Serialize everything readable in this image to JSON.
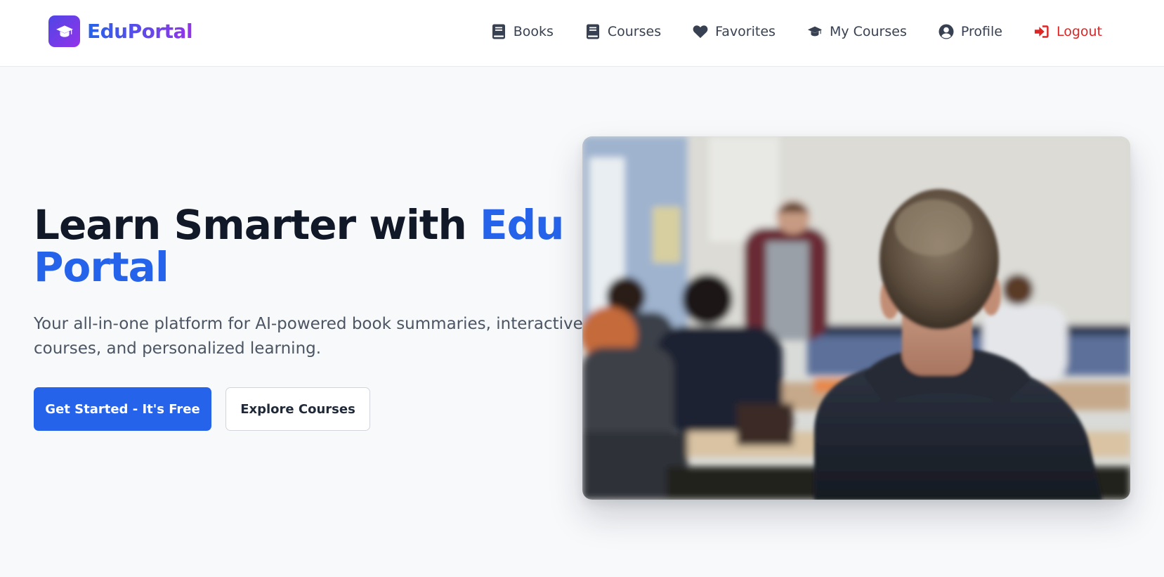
{
  "brand": {
    "name": "EduPortal",
    "logo_icon": "graduation-cap-icon",
    "gradient": [
      "#4f46e5",
      "#9333ea"
    ]
  },
  "nav": {
    "items": [
      {
        "label": "Books",
        "icon": "book-icon"
      },
      {
        "label": "Courses",
        "icon": "book-icon"
      },
      {
        "label": "Favorites",
        "icon": "heart-icon"
      },
      {
        "label": "My Courses",
        "icon": "graduation-cap-icon"
      },
      {
        "label": "Profile",
        "icon": "user-circle-icon"
      },
      {
        "label": "Logout",
        "icon": "sign-out-icon"
      }
    ]
  },
  "hero": {
    "title_main": "Learn Smarter with ",
    "title_accent": "Edu Portal",
    "subtitle": "Your all-in-one platform for AI-powered book summaries, interactive courses, and personalized learning.",
    "primary_button": "Get Started - It's Free",
    "secondary_button": "Explore Courses",
    "image": "classroom-photo"
  },
  "colors": {
    "accent": "#2563eb",
    "text_dark": "#111827",
    "text_muted": "#4b5563",
    "logout": "#dc2626",
    "background": "#f8f9fb"
  }
}
